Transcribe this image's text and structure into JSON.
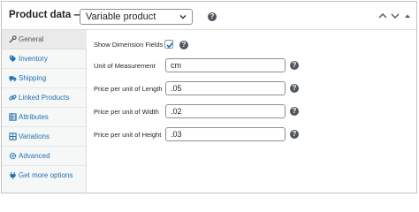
{
  "header": {
    "title": "Product data —",
    "product_type": "Variable product",
    "help_glyph": "?"
  },
  "tabs": [
    {
      "label": "General",
      "icon": "wrench-icon",
      "active": true
    },
    {
      "label": "Inventory",
      "icon": "tag-icon"
    },
    {
      "label": "Shipping",
      "icon": "truck-icon"
    },
    {
      "label": "Linked Products",
      "icon": "link-icon"
    },
    {
      "label": "Attributes",
      "icon": "table-icon"
    },
    {
      "label": "Variations",
      "icon": "grid-icon"
    },
    {
      "label": "Advanced",
      "icon": "gear-icon"
    },
    {
      "label": "Get more options",
      "icon": "plugin-icon"
    }
  ],
  "fields": {
    "show_dimension": {
      "label": "Show Dimension Fields",
      "checked": true
    },
    "unit": {
      "label": "Unit of Measurement",
      "value": "cm"
    },
    "length": {
      "label": "Price per unit of Length",
      "value": ".05"
    },
    "width": {
      "label": "Price per unit of Width",
      "value": ".02"
    },
    "height": {
      "label": "Price per unit of Height",
      "value": ".03"
    }
  },
  "colors": {
    "accent": "#2271b1",
    "border": "#c3c4c7",
    "sidebar_bg": "#f6f7f7",
    "active_tab_bg": "#eaeaea"
  }
}
